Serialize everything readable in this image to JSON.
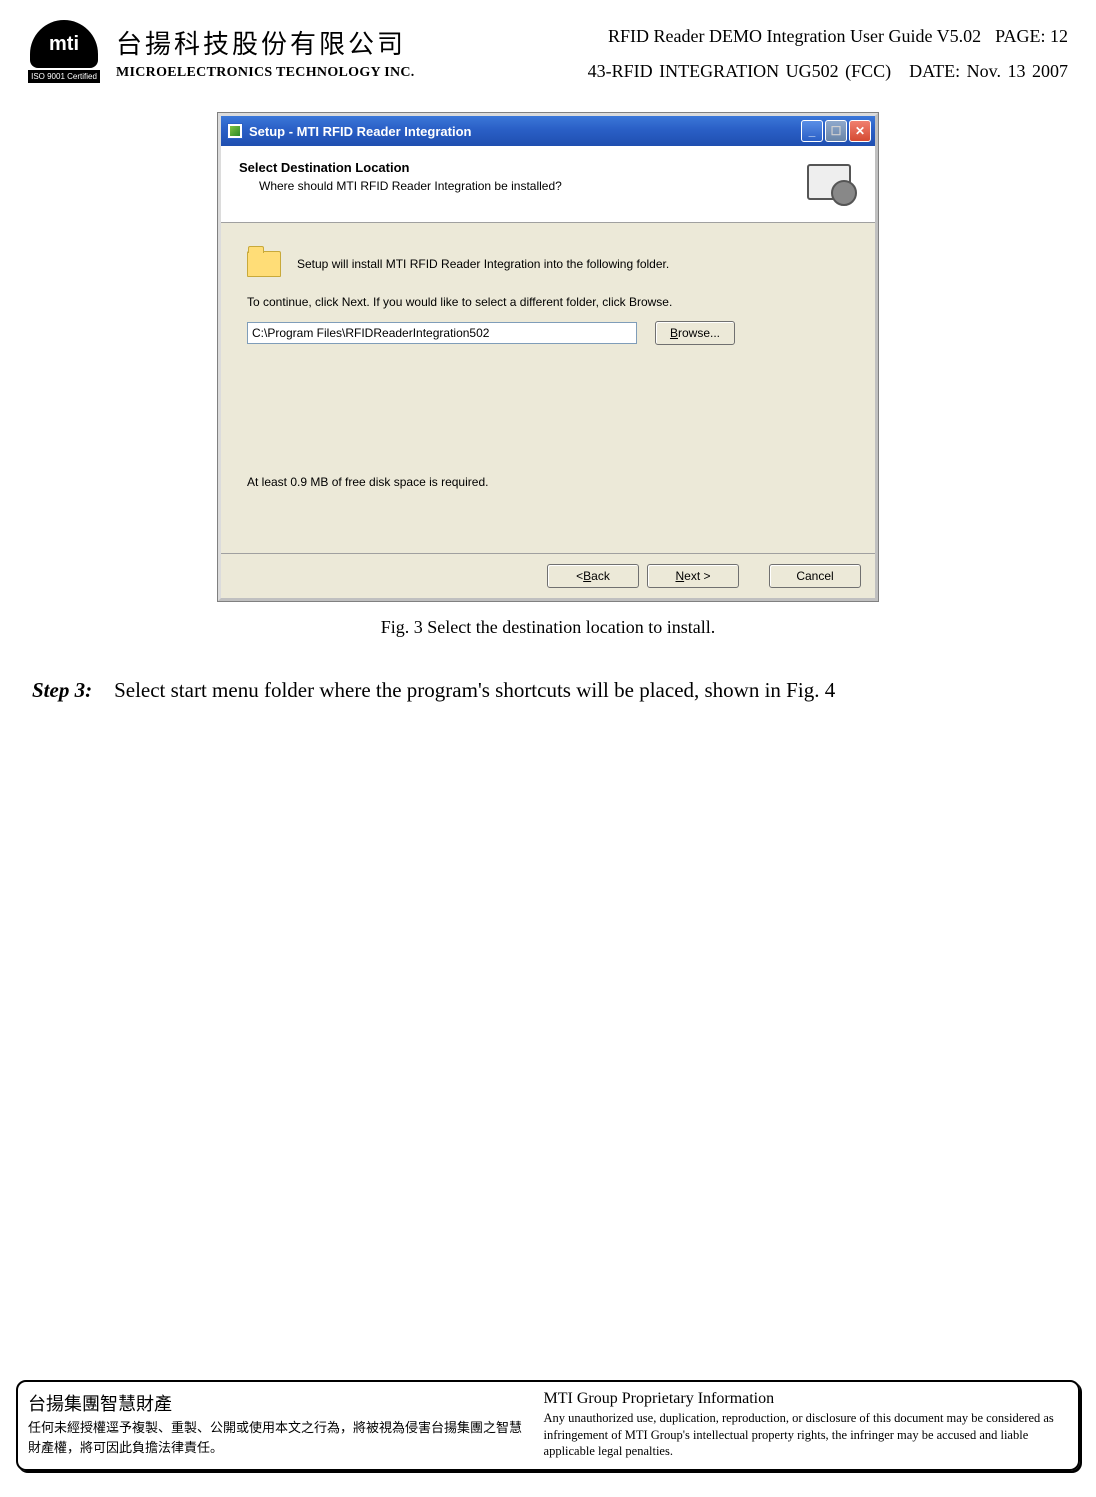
{
  "header": {
    "iso_badge": "ISO 9001 Certified",
    "company_cn": "台揚科技股份有限公司",
    "company_en": "MICROELECTRONICS TECHNOLOGY INC.",
    "guide_title": "RFID Reader DEMO Integration User Guide V5.02",
    "page_label": "PAGE: 12",
    "doc_code": "43-RFID  INTEGRATION  UG502  (FCC)",
    "date_label": "DATE:  Nov.  13  2007"
  },
  "dialog": {
    "title": "Setup - MTI RFID Reader Integration",
    "heading": "Select Destination Location",
    "subheading": "Where should MTI RFID Reader Integration be installed?",
    "install_line": "Setup will install MTI RFID Reader Integration into the following folder.",
    "continue_line": "To continue, click Next. If you would like to select a different folder, click Browse.",
    "path_value": "C:\\Program Files\\RFIDReaderIntegration502",
    "browse_label": "Browse...",
    "disk_note": "At least 0.9 MB of free disk space is required.",
    "back_label": "< Back",
    "next_label": "Next >",
    "cancel_label": "Cancel"
  },
  "figure_caption": "Fig. 3    Select the destination location to install.",
  "step": {
    "label": "Step 3:",
    "text": "Select start menu folder where the program's shortcuts will be placed, shown in Fig. 4"
  },
  "footer": {
    "cn_title": "台揚集團智慧財產",
    "cn_body": "任何未經授權逕予複製、重製、公開或使用本文之行為，將被視為侵害台揚集團之智慧財產權，將可因此負擔法律責任。",
    "en_title": "MTI Group Proprietary Information",
    "en_body": "Any unauthorized use, duplication, reproduction, or disclosure of this document may be considered as infringement of MTI Group's intellectual property rights, the infringer may be accused and liable applicable legal penalties."
  }
}
